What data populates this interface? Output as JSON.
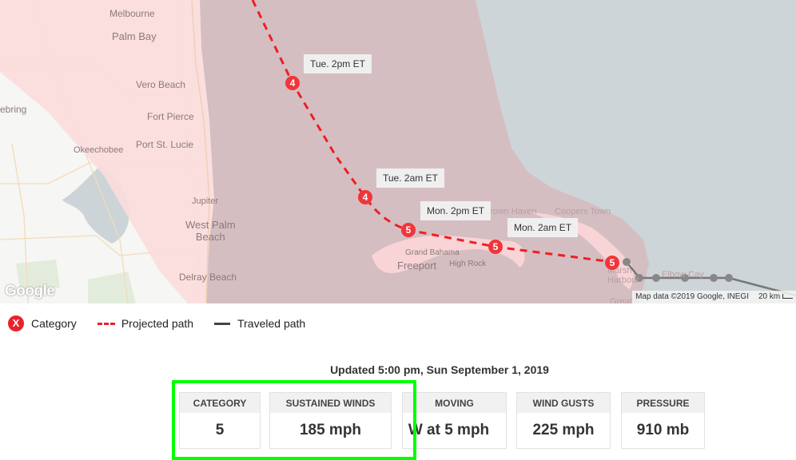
{
  "map": {
    "cities": [
      {
        "id": "melbourne",
        "name": "Melbourne"
      },
      {
        "id": "palm-bay",
        "name": "Palm Bay"
      },
      {
        "id": "vero-beach",
        "name": "Vero Beach"
      },
      {
        "id": "sebring",
        "name": "ebring"
      },
      {
        "id": "fort-pierce",
        "name": "Fort Pierce"
      },
      {
        "id": "port-st-lucie",
        "name": "Port St. Lucie"
      },
      {
        "id": "okeechobee",
        "name": "Okeechobee"
      },
      {
        "id": "jupiter",
        "name": "Jupiter"
      },
      {
        "id": "west-palm-beach",
        "name": "West Palm\nBeach"
      },
      {
        "id": "delray-beach",
        "name": "Delray Beach"
      },
      {
        "id": "grand-bahama",
        "name": "Grand Bahama"
      },
      {
        "id": "freeport",
        "name": "Freeport"
      },
      {
        "id": "high-rock",
        "name": "High Rock"
      },
      {
        "id": "crown-haven",
        "name": "Crown Haven"
      },
      {
        "id": "coopers-town",
        "name": "Coopers Town"
      },
      {
        "id": "marsh-harbour",
        "name": "Marsh\nHarbour"
      },
      {
        "id": "elbow-cay",
        "name": "Elbow Cay"
      },
      {
        "id": "great-abaco",
        "name": "Great A"
      }
    ],
    "forecast_points": [
      {
        "time_label": "Tue. 2pm ET",
        "category": "4"
      },
      {
        "time_label": "Tue. 2am ET",
        "category": "4"
      },
      {
        "time_label": "Mon. 2pm ET",
        "category": "5"
      },
      {
        "time_label": "Mon. 2am ET",
        "category": "5"
      },
      {
        "time_label": "",
        "category": "5"
      }
    ],
    "colors": {
      "projected_path": "#e8222a",
      "traveled_path": "#777777",
      "cone": "#d5bec1",
      "land_cone": "#fbdcdc",
      "water": "#cdd5d8"
    },
    "google_logo": "Google",
    "attribution": "Map data ©2019 Google, INEGI",
    "scale": "20 km"
  },
  "legend": {
    "category_symbol": "X",
    "category_label": "Category",
    "projected_label": "Projected path",
    "traveled_label": "Traveled path"
  },
  "updated": "Updated 5:00 pm, Sun September 1, 2019",
  "stats": [
    {
      "label": "CATEGORY",
      "value": "5"
    },
    {
      "label": "SUSTAINED WINDS",
      "value": "185 mph"
    },
    {
      "label": "MOVING",
      "value": "W at 5 mph"
    },
    {
      "label": "WIND GUSTS",
      "value": "225 mph"
    },
    {
      "label": "PRESSURE",
      "value": "910 mb"
    }
  ]
}
